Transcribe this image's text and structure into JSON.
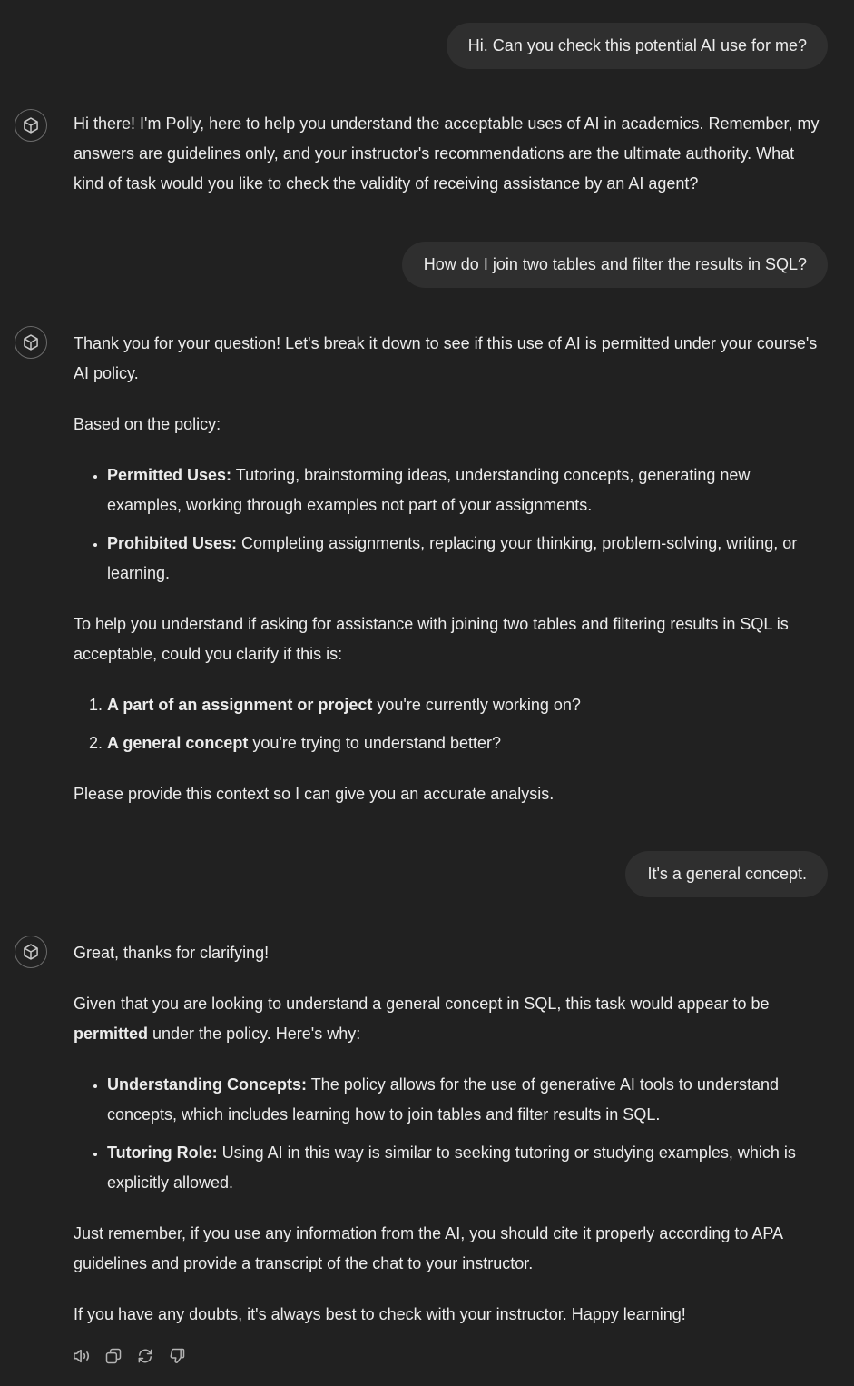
{
  "messages": [
    {
      "role": "user",
      "text": "Hi. Can you check this potential AI use for me?"
    },
    {
      "role": "assistant",
      "paragraphs": [
        "Hi there! I'm Polly, here to help you understand the acceptable uses of AI in academics. Remember, my answers are guidelines only, and your instructor's recommendations are the ultimate authority. What kind of task would you like to check the validity of receiving assistance by an AI agent?"
      ]
    },
    {
      "role": "user",
      "text": "How do I join two tables and filter the results in SQL?"
    },
    {
      "role": "assistant",
      "intro": "Thank you for your question! Let's break it down to see if this use of AI is permitted under your course's AI policy.",
      "policy_label": "Based on the policy:",
      "bullets": [
        {
          "bold": "Permitted Uses:",
          "text": " Tutoring, brainstorming ideas, understanding concepts, generating new examples, working through examples not part of your assignments."
        },
        {
          "bold": "Prohibited Uses:",
          "text": " Completing assignments, replacing your thinking, problem-solving, writing, or learning."
        }
      ],
      "clarify": "To help you understand if asking for assistance with joining two tables and filtering results in SQL is acceptable, could you clarify if this is:",
      "options": [
        {
          "bold": "A part of an assignment or project",
          "text": " you're currently working on?"
        },
        {
          "bold": "A general concept",
          "text": " you're trying to understand better?"
        }
      ],
      "closing": "Please provide this context so I can give you an accurate analysis."
    },
    {
      "role": "user",
      "text": "It's a general concept."
    },
    {
      "role": "assistant",
      "intro": "Great, thanks for clarifying!",
      "verdict_pre": "Given that you are looking to understand a general concept in SQL, this task would appear to be ",
      "verdict_bold": "permitted",
      "verdict_post": " under the policy. Here's why:",
      "bullets": [
        {
          "bold": "Understanding Concepts:",
          "text": " The policy allows for the use of generative AI tools to understand concepts, which includes learning how to join tables and filter results in SQL."
        },
        {
          "bold": "Tutoring Role:",
          "text": " Using AI in this way is similar to seeking tutoring or studying examples, which is explicitly allowed."
        }
      ],
      "reminder": "Just remember, if you use any information from the AI, you should cite it properly according to APA guidelines and provide a transcript of the chat to your instructor.",
      "signoff": "If you have any doubts, it's always best to check with your instructor. Happy learning!"
    }
  ],
  "actions": [
    {
      "icon": "speaker-icon",
      "label": "Read aloud"
    },
    {
      "icon": "copy-icon",
      "label": "Copy"
    },
    {
      "icon": "regenerate-icon",
      "label": "Regenerate"
    },
    {
      "icon": "thumbs-down-icon",
      "label": "Bad response"
    }
  ],
  "colors": {
    "background": "#212121",
    "bubble": "#2f2f2f",
    "text": "#ececec",
    "icon": "#b4b4b4"
  }
}
